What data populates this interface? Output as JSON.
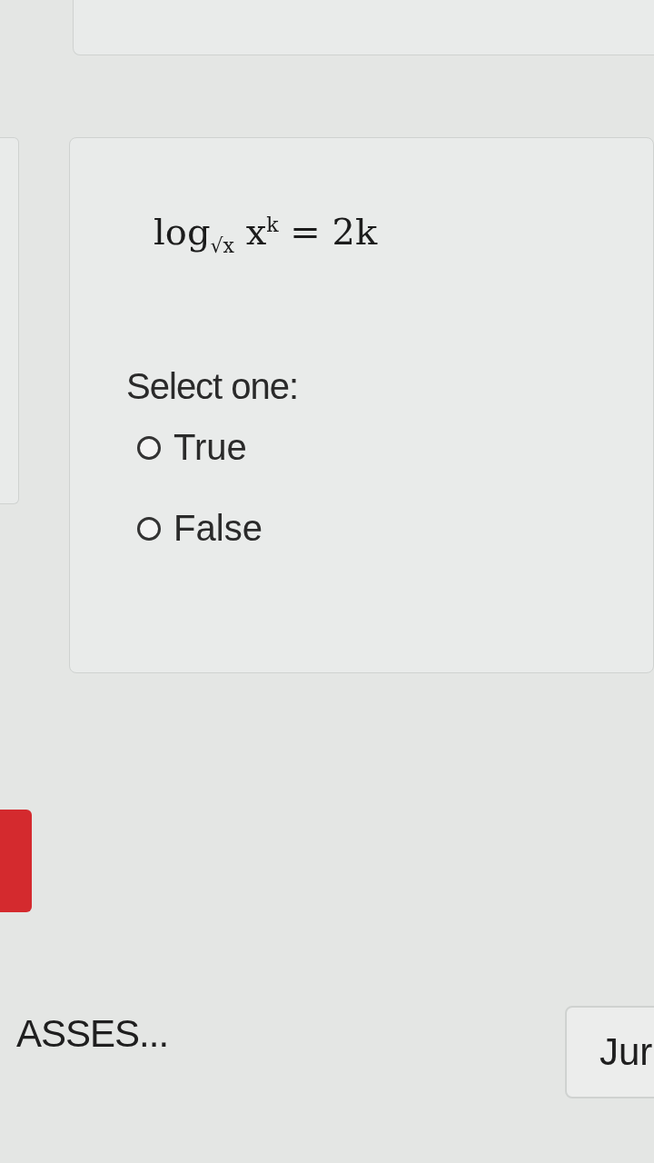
{
  "question": {
    "formula": "log$_{√x}$ x$^{k}$ = 2k",
    "prompt": "Select one:",
    "options": [
      {
        "label": "True",
        "selected": false
      },
      {
        "label": "False",
        "selected": false
      }
    ]
  },
  "footer": {
    "previous_link": "ASSES...",
    "jump_button": "Jur"
  }
}
